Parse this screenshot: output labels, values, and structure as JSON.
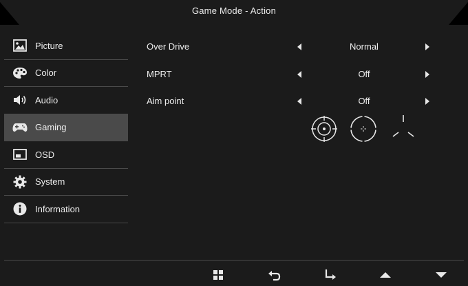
{
  "header": {
    "title": "Game Mode - Action"
  },
  "sidebar": {
    "items": [
      {
        "label": "Picture",
        "icon": "picture-icon",
        "active": false
      },
      {
        "label": "Color",
        "icon": "palette-icon",
        "active": false
      },
      {
        "label": "Audio",
        "icon": "speaker-icon",
        "active": false
      },
      {
        "label": "Gaming",
        "icon": "gamepad-icon",
        "active": true
      },
      {
        "label": "OSD",
        "icon": "osd-window-icon",
        "active": false
      },
      {
        "label": "System",
        "icon": "gear-icon",
        "active": false
      },
      {
        "label": "Information",
        "icon": "info-icon",
        "active": false
      }
    ]
  },
  "settings": {
    "rows": [
      {
        "label": "Over Drive",
        "value": "Normal"
      },
      {
        "label": "MPRT",
        "value": "Off"
      },
      {
        "label": "Aim point",
        "value": "Off"
      }
    ],
    "aim_point_options": [
      "crosshair-circle-icon",
      "crosshair-dot-circle-icon",
      "crosshair-tri-icon"
    ]
  },
  "bottom_nav": {
    "buttons": [
      "menu-grid-icon",
      "back-icon",
      "enter-icon",
      "up-icon",
      "down-icon"
    ]
  },
  "colors": {
    "panel": "#1b1b1b",
    "highlight": "#4a4a4a",
    "text": "#ececec"
  }
}
